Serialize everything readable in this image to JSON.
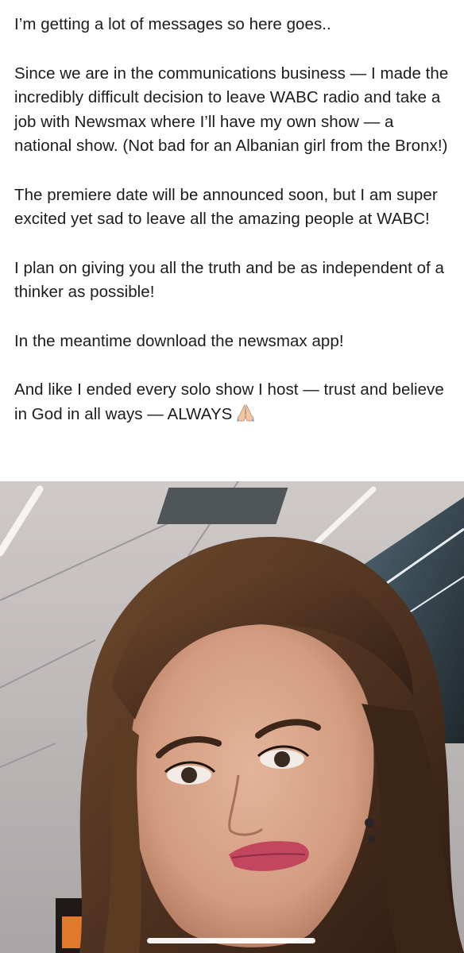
{
  "post": {
    "paragraphs": [
      "I’m getting a lot of messages so here goes..",
      "Since we are in the communications business — I made the incredibly difficult decision to leave WABC radio and take a job with Newsmax where I’ll have my own show — a national show. (Not bad for an Albanian girl from the Bronx!)",
      "The premiere date will be announced soon, but I am super excited yet sad to leave all the amazing people at WABC!",
      "I plan on giving you all the truth and be as independent of a thinker as possible!",
      "In the meantime download the newsmax app!",
      "And like I ended every solo show I host — trust and believe in God in all ways — ALWAYS"
    ],
    "closing_emoji": "folded-hands-icon"
  },
  "photo": {
    "subject": "selfie-photo"
  },
  "colors": {
    "text": "#1c1c1e",
    "background": "#ffffff",
    "hair": "#5a3a22",
    "skin": "#d7a68c",
    "lips": "#c2475e"
  }
}
